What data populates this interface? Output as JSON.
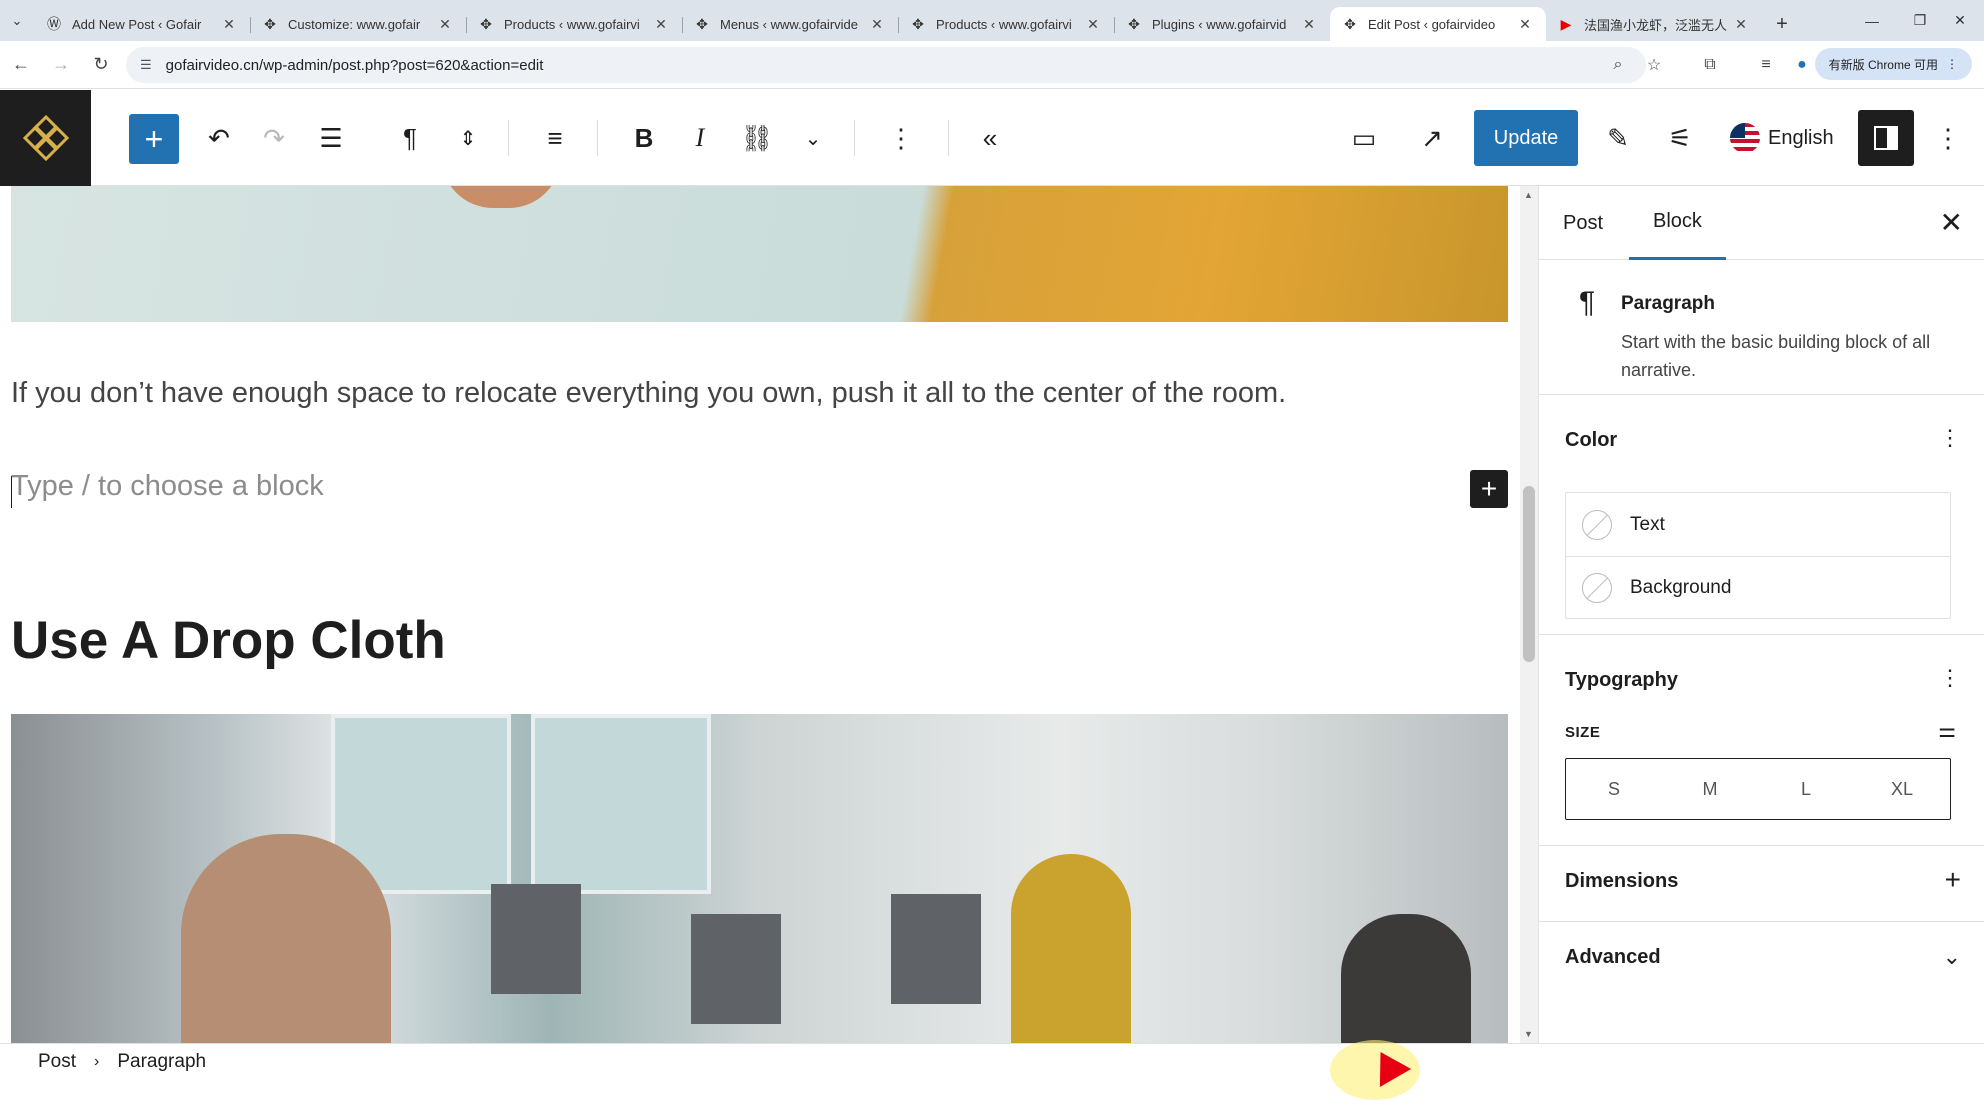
{
  "browser": {
    "tabs": [
      {
        "title": "Add New Post ‹ Gofair",
        "icon": "wordpress-icon",
        "active": false
      },
      {
        "title": "Customize: www.gofair",
        "icon": "site-favicon",
        "active": false
      },
      {
        "title": "Products ‹ www.gofairvi",
        "icon": "site-favicon",
        "active": false
      },
      {
        "title": "Menus ‹ www.gofairvide",
        "icon": "site-favicon",
        "active": false
      },
      {
        "title": "Products ‹ www.gofairvi",
        "icon": "site-favicon",
        "active": false
      },
      {
        "title": "Plugins ‹ www.gofairvid",
        "icon": "site-favicon",
        "active": false
      },
      {
        "title": "Edit Post ‹ gofairvideo",
        "icon": "site-favicon",
        "active": true
      },
      {
        "title": "法国渔小龙虾，泛滥无人",
        "icon": "youtube-icon",
        "active": false
      }
    ],
    "url": "gofairvideo.cn/wp-admin/post.php?post=620&action=edit",
    "chrome_update_label": "有新版 Chrome 可用"
  },
  "toolbar": {
    "update_label": "Update",
    "language_label": "English",
    "accent_color": "#2271b1"
  },
  "content": {
    "paragraph": "If you don’t have enough space to relocate everything you own, push it all to the center of the room.",
    "placeholder": "Type / to choose a block",
    "heading": "Use A Drop Cloth"
  },
  "sidebar": {
    "tabs": [
      "Post",
      "Block"
    ],
    "active_tab": "Block",
    "block_name": "Paragraph",
    "block_description": "Start with the basic building block of all narrative.",
    "color_title": "Color",
    "color_items": [
      "Text",
      "Background"
    ],
    "typography_title": "Typography",
    "size_label": "SIZE",
    "size_options": [
      "S",
      "M",
      "L",
      "XL"
    ],
    "dimensions_title": "Dimensions",
    "advanced_title": "Advanced"
  },
  "breadcrumb": [
    "Post",
    "Paragraph"
  ]
}
